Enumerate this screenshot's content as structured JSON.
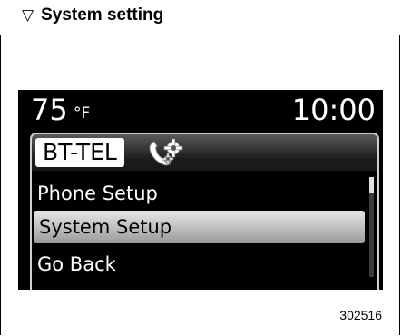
{
  "heading": {
    "marker": "▽",
    "title": "System setting"
  },
  "display": {
    "status_bar": {
      "temperature": "75",
      "temperature_unit": "°F",
      "clock": "10:00"
    },
    "title": "BT-TEL",
    "title_icon": "phone-gear-icon",
    "menu": {
      "items": [
        {
          "label": "Phone Setup",
          "selected": false
        },
        {
          "label": "System Setup",
          "selected": true
        },
        {
          "label": "Go Back",
          "selected": false
        }
      ]
    },
    "colors": {
      "screen_background": "#000000",
      "highlight": "#cccccc",
      "text": "#ffffff"
    }
  },
  "figure_code": "302516"
}
